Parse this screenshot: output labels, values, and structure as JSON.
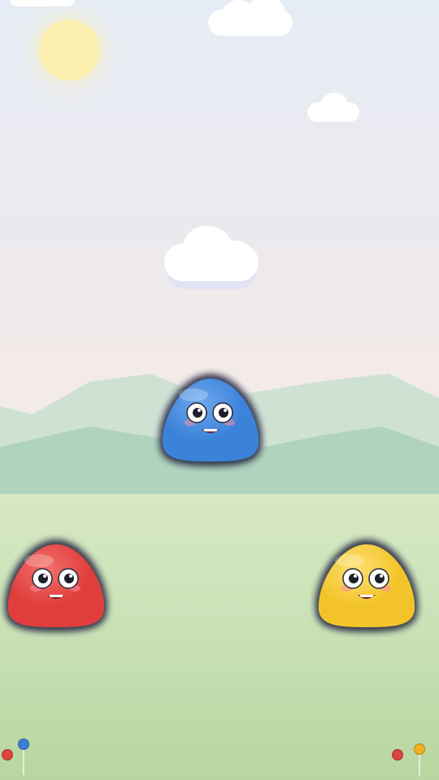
{
  "scene": {
    "sky_top_color": "#e6ecf5",
    "sky_bottom_color": "#f2ece6",
    "sun_color": "#fbefb0",
    "hill_back_color": "#cfe1d3",
    "hill_front_color": "#afd3bd",
    "ground_color": "#c9e2b6"
  },
  "slimes": [
    {
      "id": "blue",
      "color": "#3b82d9",
      "highlight": "#6ea8ee",
      "role": "active"
    },
    {
      "id": "red",
      "color": "#e03e3c",
      "highlight": "#f2706b",
      "role": "idle"
    },
    {
      "id": "yellow",
      "color": "#f3c42a",
      "highlight": "#fde070",
      "role": "idle"
    }
  ],
  "markers": {
    "left": [
      {
        "color": "#e0423e"
      },
      {
        "color": "#3c7fd8"
      }
    ],
    "right": [
      {
        "color": "#e0423e"
      },
      {
        "color": "#f0b21f"
      }
    ]
  }
}
